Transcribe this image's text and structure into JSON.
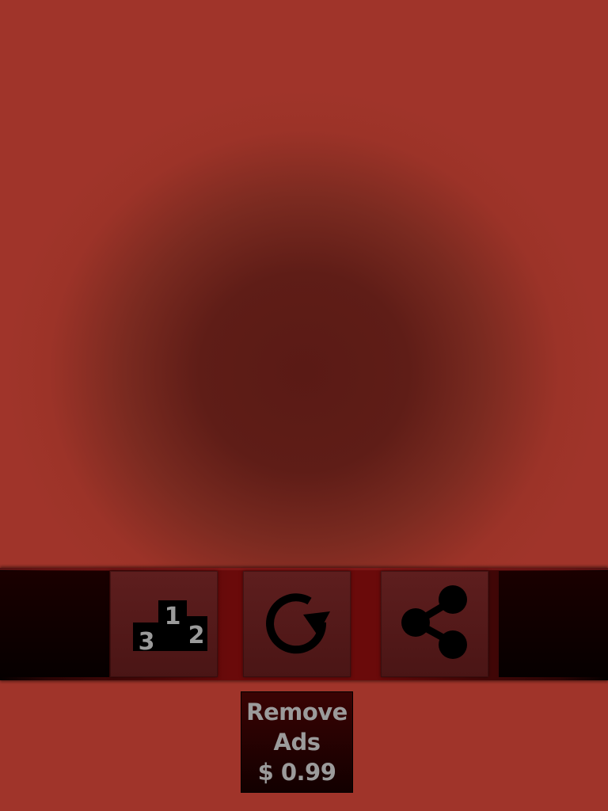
{
  "toolbar": {
    "buttons": [
      {
        "id": "leaderboard",
        "icon": "podium-icon",
        "podium_numbers": [
          "1",
          "2",
          "3"
        ]
      },
      {
        "id": "restart",
        "icon": "restart-icon"
      },
      {
        "id": "share",
        "icon": "share-icon"
      }
    ]
  },
  "remove_ads": {
    "line1": "Remove",
    "line2": "Ads",
    "price": "$ 0.99"
  },
  "colors": {
    "background": "#a0342a",
    "center_shade": "#5a1a15",
    "icon": "#000000",
    "podium_number": "#9b9b9b",
    "ads_text": "#9b9b9b"
  }
}
